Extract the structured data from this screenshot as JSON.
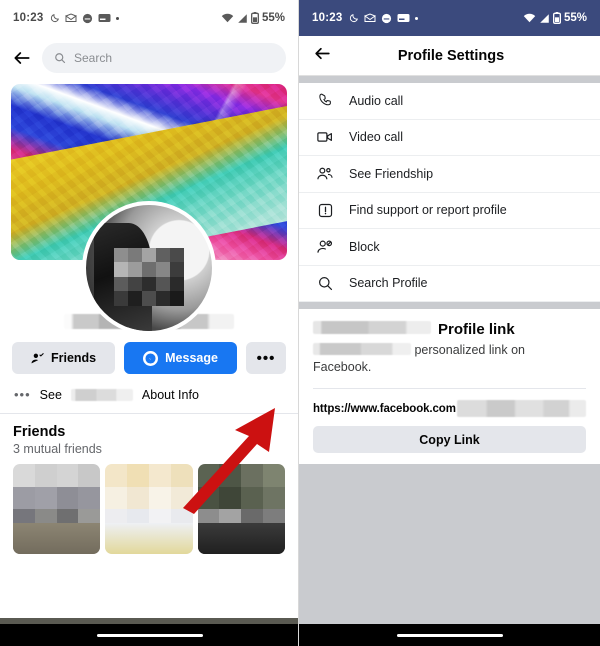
{
  "status_bar": {
    "time": "10:23",
    "battery_text": "55%",
    "icons": [
      "moon-icon",
      "envelope-icon",
      "chat-face-icon",
      "card-icon",
      "dot-icon"
    ],
    "right_icons": [
      "wifi-icon",
      "signal-icon",
      "battery-icon"
    ],
    "dark_background": "#3b4a7d",
    "light_background": "#ffffff"
  },
  "left_panel": {
    "search": {
      "placeholder": "Search",
      "icon": "search-icon"
    },
    "back_icon": "back-arrow-icon",
    "profile": {
      "name": "",
      "cover_photo_alt": "abstract paint cover photo",
      "avatar_alt": "blurred profile photo"
    },
    "buttons": {
      "friends_label": "Friends",
      "message_label": "Message",
      "more_label": "•••"
    },
    "about_row": {
      "prefix": "See",
      "suffix": "About Info",
      "icon": "three-dots-icon"
    },
    "friends_section": {
      "title": "Friends",
      "subtitle": "3 mutual friends",
      "cards": [
        {
          "alt": "friend photo 1"
        },
        {
          "alt": "friend photo 2"
        },
        {
          "alt": "friend photo 3"
        }
      ]
    }
  },
  "right_panel": {
    "header": {
      "title": "Profile Settings",
      "back_icon": "back-arrow-icon"
    },
    "menu_items": [
      {
        "label": "Audio call",
        "icon": "phone-icon"
      },
      {
        "label": "Video call",
        "icon": "video-camera-icon"
      },
      {
        "label": "See Friendship",
        "icon": "people-icon"
      },
      {
        "label": "Find support or report profile",
        "icon": "report-icon"
      },
      {
        "label": "Block",
        "icon": "block-user-icon"
      },
      {
        "label": "Search Profile",
        "icon": "search-icon"
      }
    ],
    "profile_link": {
      "title": "Profile link",
      "description_text": "personalized link on Facebook.",
      "url": "https://www.facebook.com",
      "copy_label": "Copy Link"
    }
  },
  "annotations": {
    "arrow_color": "#cc1111",
    "left_arrow_target": "more-options-button",
    "right_arrow_target": "menu-item-block"
  }
}
